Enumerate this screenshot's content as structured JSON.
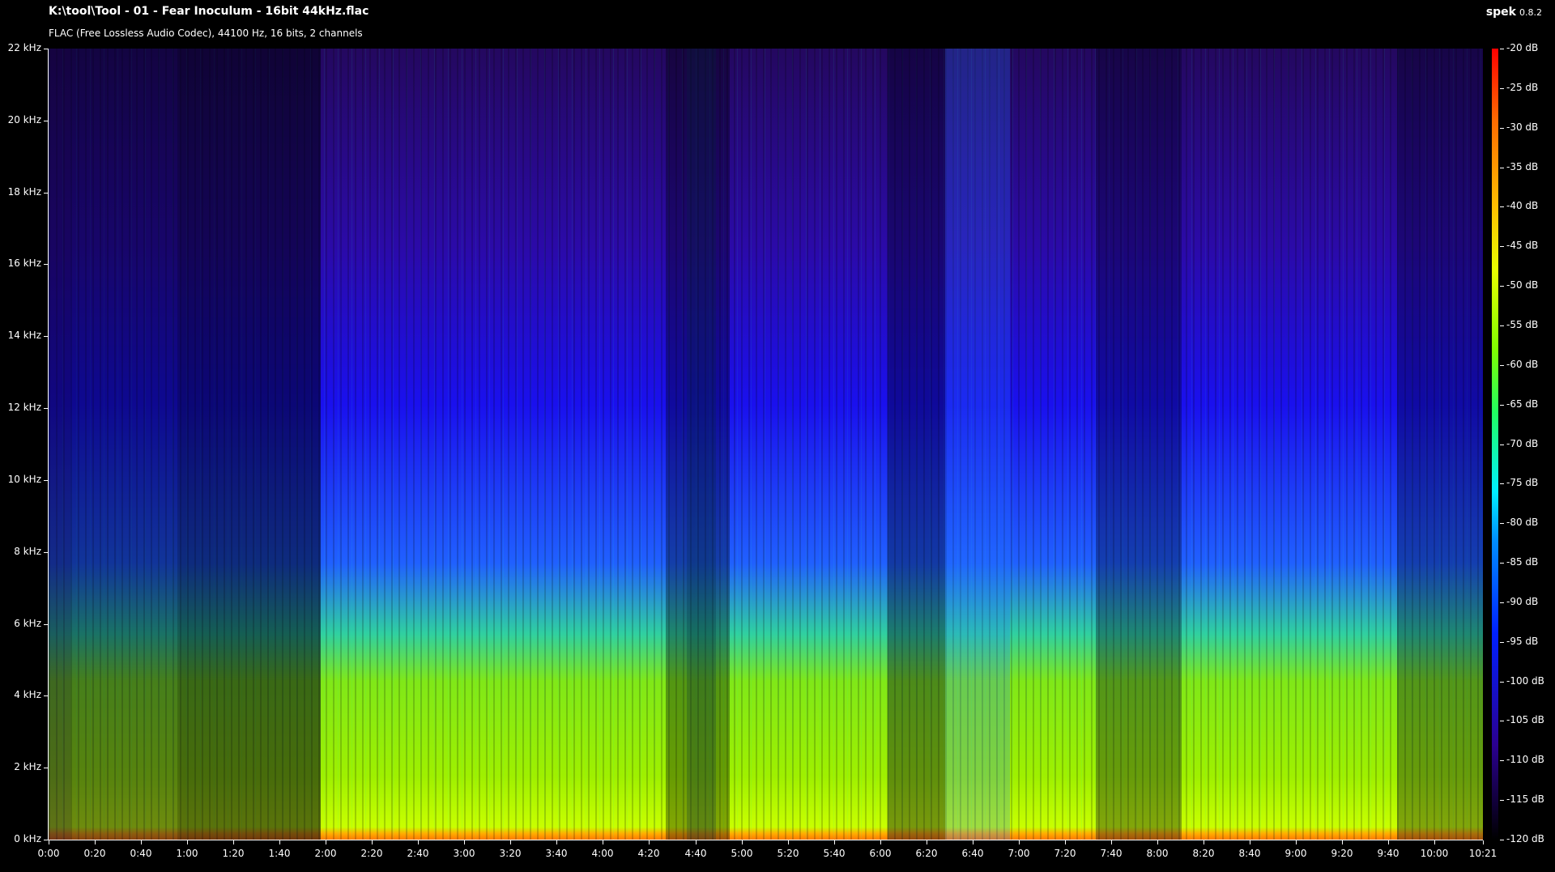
{
  "window": {
    "title": "K:\\tool\\Tool - 01 - Fear Inoculum - 16bit 44kHz.flac",
    "subtitle": "FLAC (Free Lossless Audio Codec), 44100 Hz, 16 bits, 2 channels",
    "brand": "spek",
    "version": "0.8.2"
  },
  "colors": {
    "background": "#000000",
    "text": "#ffffff"
  },
  "chart_data": {
    "type": "heatmap",
    "title": "",
    "xlabel": "",
    "ylabel": "",
    "x_ticks": [
      "0:00",
      "0:20",
      "0:40",
      "1:00",
      "1:20",
      "1:40",
      "2:00",
      "2:20",
      "2:40",
      "3:00",
      "3:20",
      "3:40",
      "4:00",
      "4:20",
      "4:40",
      "5:00",
      "5:20",
      "5:40",
      "6:00",
      "6:20",
      "6:40",
      "7:00",
      "7:20",
      "7:40",
      "8:00",
      "8:20",
      "8:40",
      "9:00",
      "9:20",
      "9:40",
      "10:00",
      "10:21"
    ],
    "x_tick_seconds": [
      0,
      20,
      40,
      60,
      80,
      100,
      120,
      140,
      160,
      180,
      200,
      220,
      240,
      260,
      280,
      300,
      320,
      340,
      360,
      380,
      400,
      420,
      440,
      460,
      480,
      500,
      520,
      540,
      560,
      580,
      600,
      621
    ],
    "xlim_seconds": [
      0,
      621
    ],
    "y_ticks": [
      "0 kHz",
      "2 kHz",
      "4 kHz",
      "6 kHz",
      "8 kHz",
      "10 kHz",
      "12 kHz",
      "14 kHz",
      "16 kHz",
      "18 kHz",
      "20 kHz",
      "22 kHz"
    ],
    "y_tick_khz": [
      0,
      2,
      4,
      6,
      8,
      10,
      12,
      14,
      16,
      18,
      20,
      22
    ],
    "ylim_khz": [
      0,
      22
    ],
    "colorbar_ticks": [
      "-20 dB",
      "-25 dB",
      "-30 dB",
      "-35 dB",
      "-40 dB",
      "-45 dB",
      "-50 dB",
      "-55 dB",
      "-60 dB",
      "-65 dB",
      "-70 dB",
      "-75 dB",
      "-80 dB",
      "-85 dB",
      "-90 dB",
      "-95 dB",
      "-100 dB",
      "-105 dB",
      "-110 dB",
      "-115 dB",
      "-120 dB"
    ],
    "colorbar_db": [
      -20,
      -25,
      -30,
      -35,
      -40,
      -45,
      -50,
      -55,
      -60,
      -65,
      -70,
      -75,
      -80,
      -85,
      -90,
      -95,
      -100,
      -105,
      -110,
      -115,
      -120
    ],
    "colorbar_range_db": [
      -120,
      -20
    ]
  }
}
